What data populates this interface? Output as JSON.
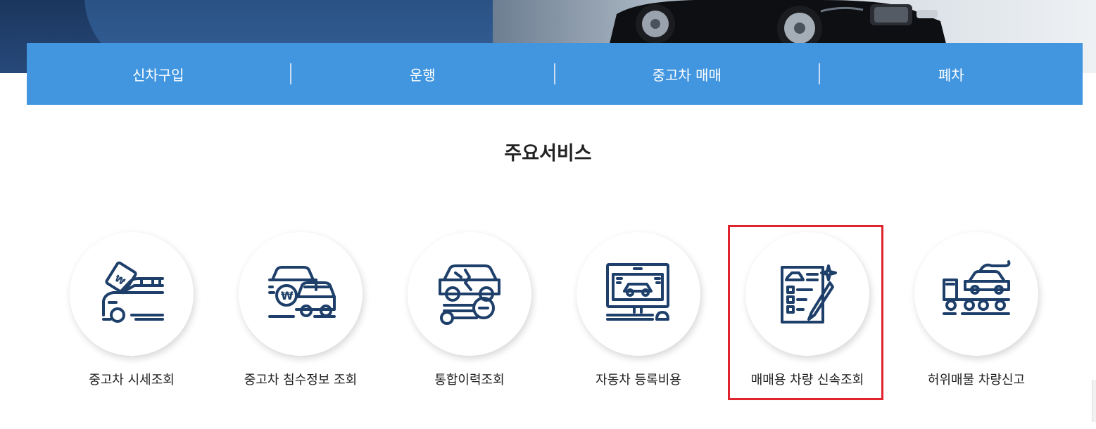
{
  "nav": {
    "items": [
      {
        "label": "신차구입"
      },
      {
        "label": "운행"
      },
      {
        "label": "중고차 매매"
      },
      {
        "label": "폐차"
      }
    ]
  },
  "main": {
    "title": "주요서비스",
    "services": [
      {
        "label": "중고차 시세조회",
        "icon": "car-price-tag-icon"
      },
      {
        "label": "중고차 침수정보 조회",
        "icon": "flooded-cars-icon"
      },
      {
        "label": "통합이력조회",
        "icon": "car-repair-history-icon"
      },
      {
        "label": "자동차 등록비용",
        "icon": "monitor-car-icon"
      },
      {
        "label": "매매용 차량 신속조회",
        "icon": "document-pen-icon",
        "highlighted": true
      },
      {
        "label": "허위매물 차량신고",
        "icon": "tow-truck-icon"
      }
    ]
  },
  "colors": {
    "nav_bg": "#4296df",
    "icon_color": "#1e3f6a",
    "highlight": "#e0242e"
  }
}
